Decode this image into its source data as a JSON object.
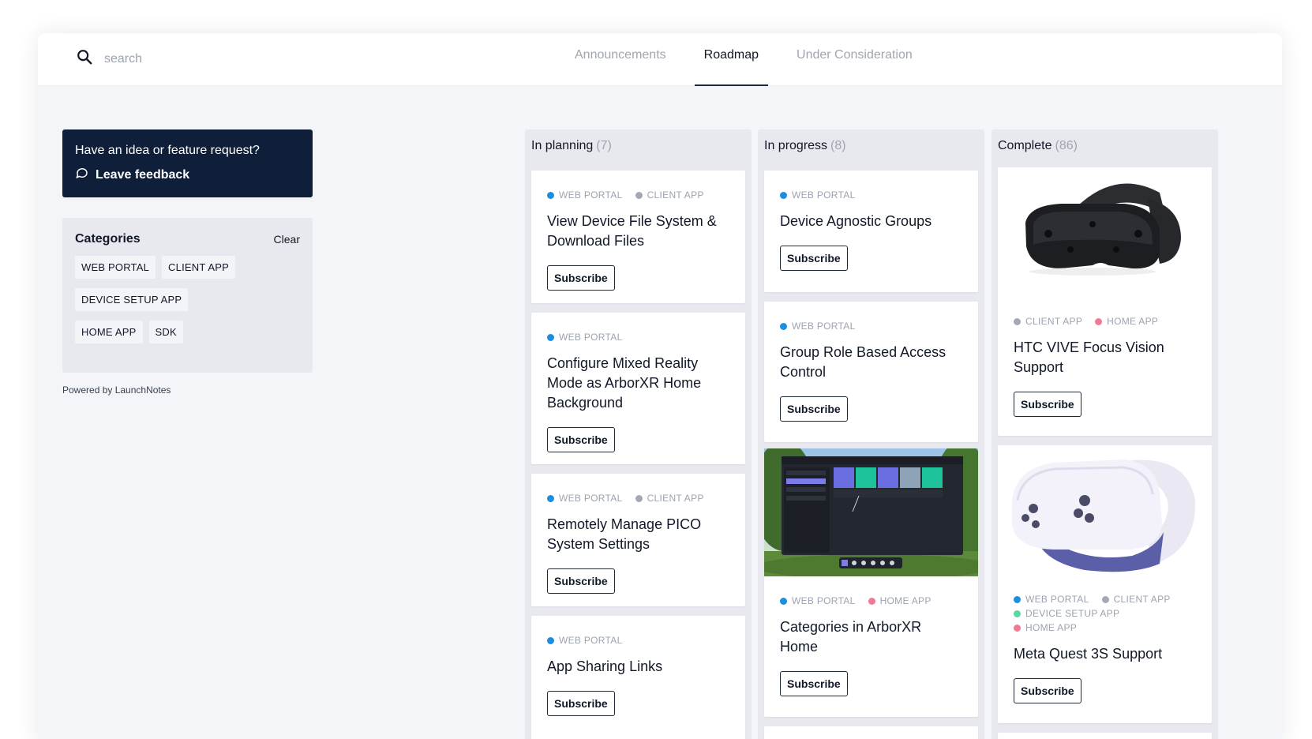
{
  "search": {
    "placeholder": "search",
    "icon": "search-icon"
  },
  "tabs": [
    {
      "label": "Announcements",
      "active": false
    },
    {
      "label": "Roadmap",
      "active": true
    },
    {
      "label": "Under Consideration",
      "active": false
    }
  ],
  "feedback": {
    "question": "Have an idea or feature request?",
    "link_label": "Leave feedback",
    "icon": "chat-bubble-icon"
  },
  "categories": {
    "title": "Categories",
    "clear_label": "Clear",
    "items": [
      "WEB PORTAL",
      "CLIENT APP",
      "DEVICE SETUP APP",
      "HOME APP",
      "SDK"
    ]
  },
  "powered_by": "Powered by LaunchNotes",
  "colors": {
    "web_portal": "#1a8ee0",
    "client_app": "#a3a8b3",
    "home_app": "#f07a94",
    "device_setup_app": "#5cd6a0",
    "feedback_bg": "#0f1f3a"
  },
  "columns": [
    {
      "title": "In planning",
      "count": "(7)",
      "cards": [
        {
          "tags": [
            "WEB PORTAL",
            "CLIENT APP"
          ],
          "title": "View Device File System & Download Files",
          "button": "Subscribe"
        },
        {
          "tags": [
            "WEB PORTAL"
          ],
          "title": "Configure Mixed Reality Mode as ArborXR Home Background",
          "button": "Subscribe"
        },
        {
          "tags": [
            "WEB PORTAL",
            "CLIENT APP"
          ],
          "title": "Remotely Manage PICO System Settings",
          "button": "Subscribe"
        },
        {
          "tags": [
            "WEB PORTAL"
          ],
          "title": "App Sharing Links",
          "button": "Subscribe"
        }
      ]
    },
    {
      "title": "In progress",
      "count": "(8)",
      "cards": [
        {
          "tags": [
            "WEB PORTAL"
          ],
          "title": "Device Agnostic Groups",
          "button": "Subscribe"
        },
        {
          "tags": [
            "WEB PORTAL"
          ],
          "title": "Group Role Based Access Control",
          "button": "Subscribe"
        },
        {
          "tags": [
            "WEB PORTAL",
            "HOME APP"
          ],
          "title": "Categories in ArborXR Home",
          "button": "Subscribe",
          "image": "arborxr-home-screenshot"
        }
      ]
    },
    {
      "title": "Complete",
      "count": "(86)",
      "cards": [
        {
          "tags": [
            "CLIENT APP",
            "HOME APP"
          ],
          "title": "HTC VIVE Focus Vision Support",
          "button": "Subscribe",
          "image": "vr-headset-black"
        },
        {
          "tags": [
            "WEB PORTAL",
            "CLIENT APP",
            "DEVICE SETUP APP",
            "HOME APP"
          ],
          "title": "Meta Quest 3S Support",
          "button": "Subscribe",
          "image": "vr-headset-white"
        }
      ]
    }
  ]
}
